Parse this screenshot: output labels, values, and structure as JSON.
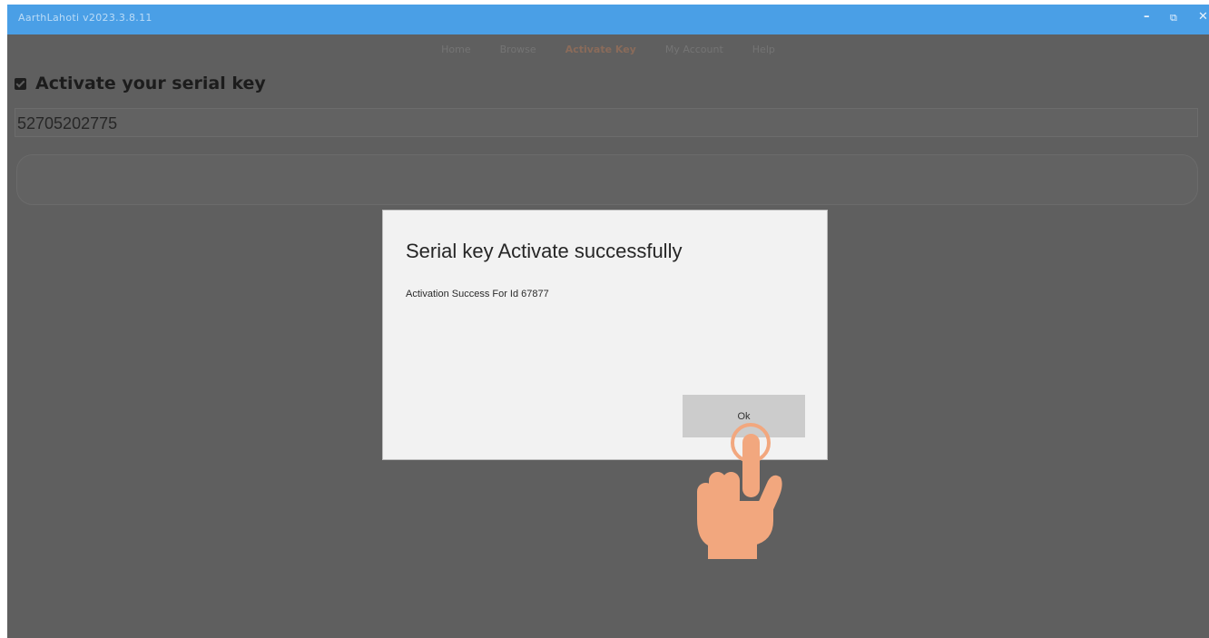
{
  "window": {
    "title": "AarthLahoti v2023.3.8.11",
    "controls": {
      "minimize": "–",
      "maximize": "⧉",
      "close": "✕"
    }
  },
  "nav": {
    "items": [
      {
        "label": "Home"
      },
      {
        "label": "Browse"
      },
      {
        "label": "Activate Key",
        "active": true
      },
      {
        "label": "My Account"
      },
      {
        "label": "Help"
      }
    ]
  },
  "section": {
    "heading": "Activate your serial key",
    "icon": "checkbox-icon"
  },
  "serial_input": {
    "value": "52705202775"
  },
  "dialog": {
    "heading": "Serial key Activate successfully",
    "message": "Activation Success For Id 67877",
    "ok_label": "Ok"
  },
  "overlay": {
    "pointer": "tap-hand-icon"
  },
  "colors": {
    "titlebar": "#4a9fe6",
    "background": "#5f5f5f",
    "dialog": "#f2f2f2",
    "hand": "#f2a77e"
  }
}
